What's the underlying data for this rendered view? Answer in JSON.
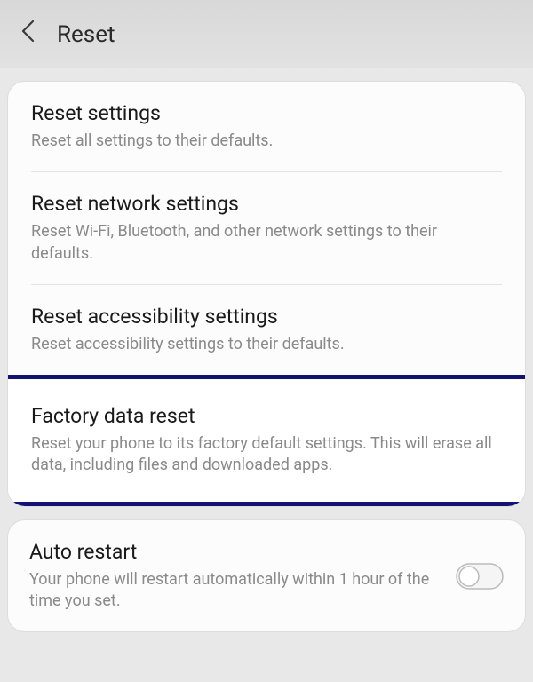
{
  "header": {
    "title": "Reset"
  },
  "items": [
    {
      "title": "Reset settings",
      "desc": "Reset all settings to their defaults."
    },
    {
      "title": "Reset network settings",
      "desc": "Reset Wi-Fi, Bluetooth, and other network settings to their defaults."
    },
    {
      "title": "Reset accessibility settings",
      "desc": "Reset accessibility settings to their defaults."
    },
    {
      "title": "Factory data reset",
      "desc": "Reset your phone to its factory default settings. This will erase all data, including files and downloaded apps."
    }
  ],
  "autoRestart": {
    "title": "Auto restart",
    "desc": "Your phone will restart automatically within 1 hour of the time you set.",
    "enabled": false
  }
}
